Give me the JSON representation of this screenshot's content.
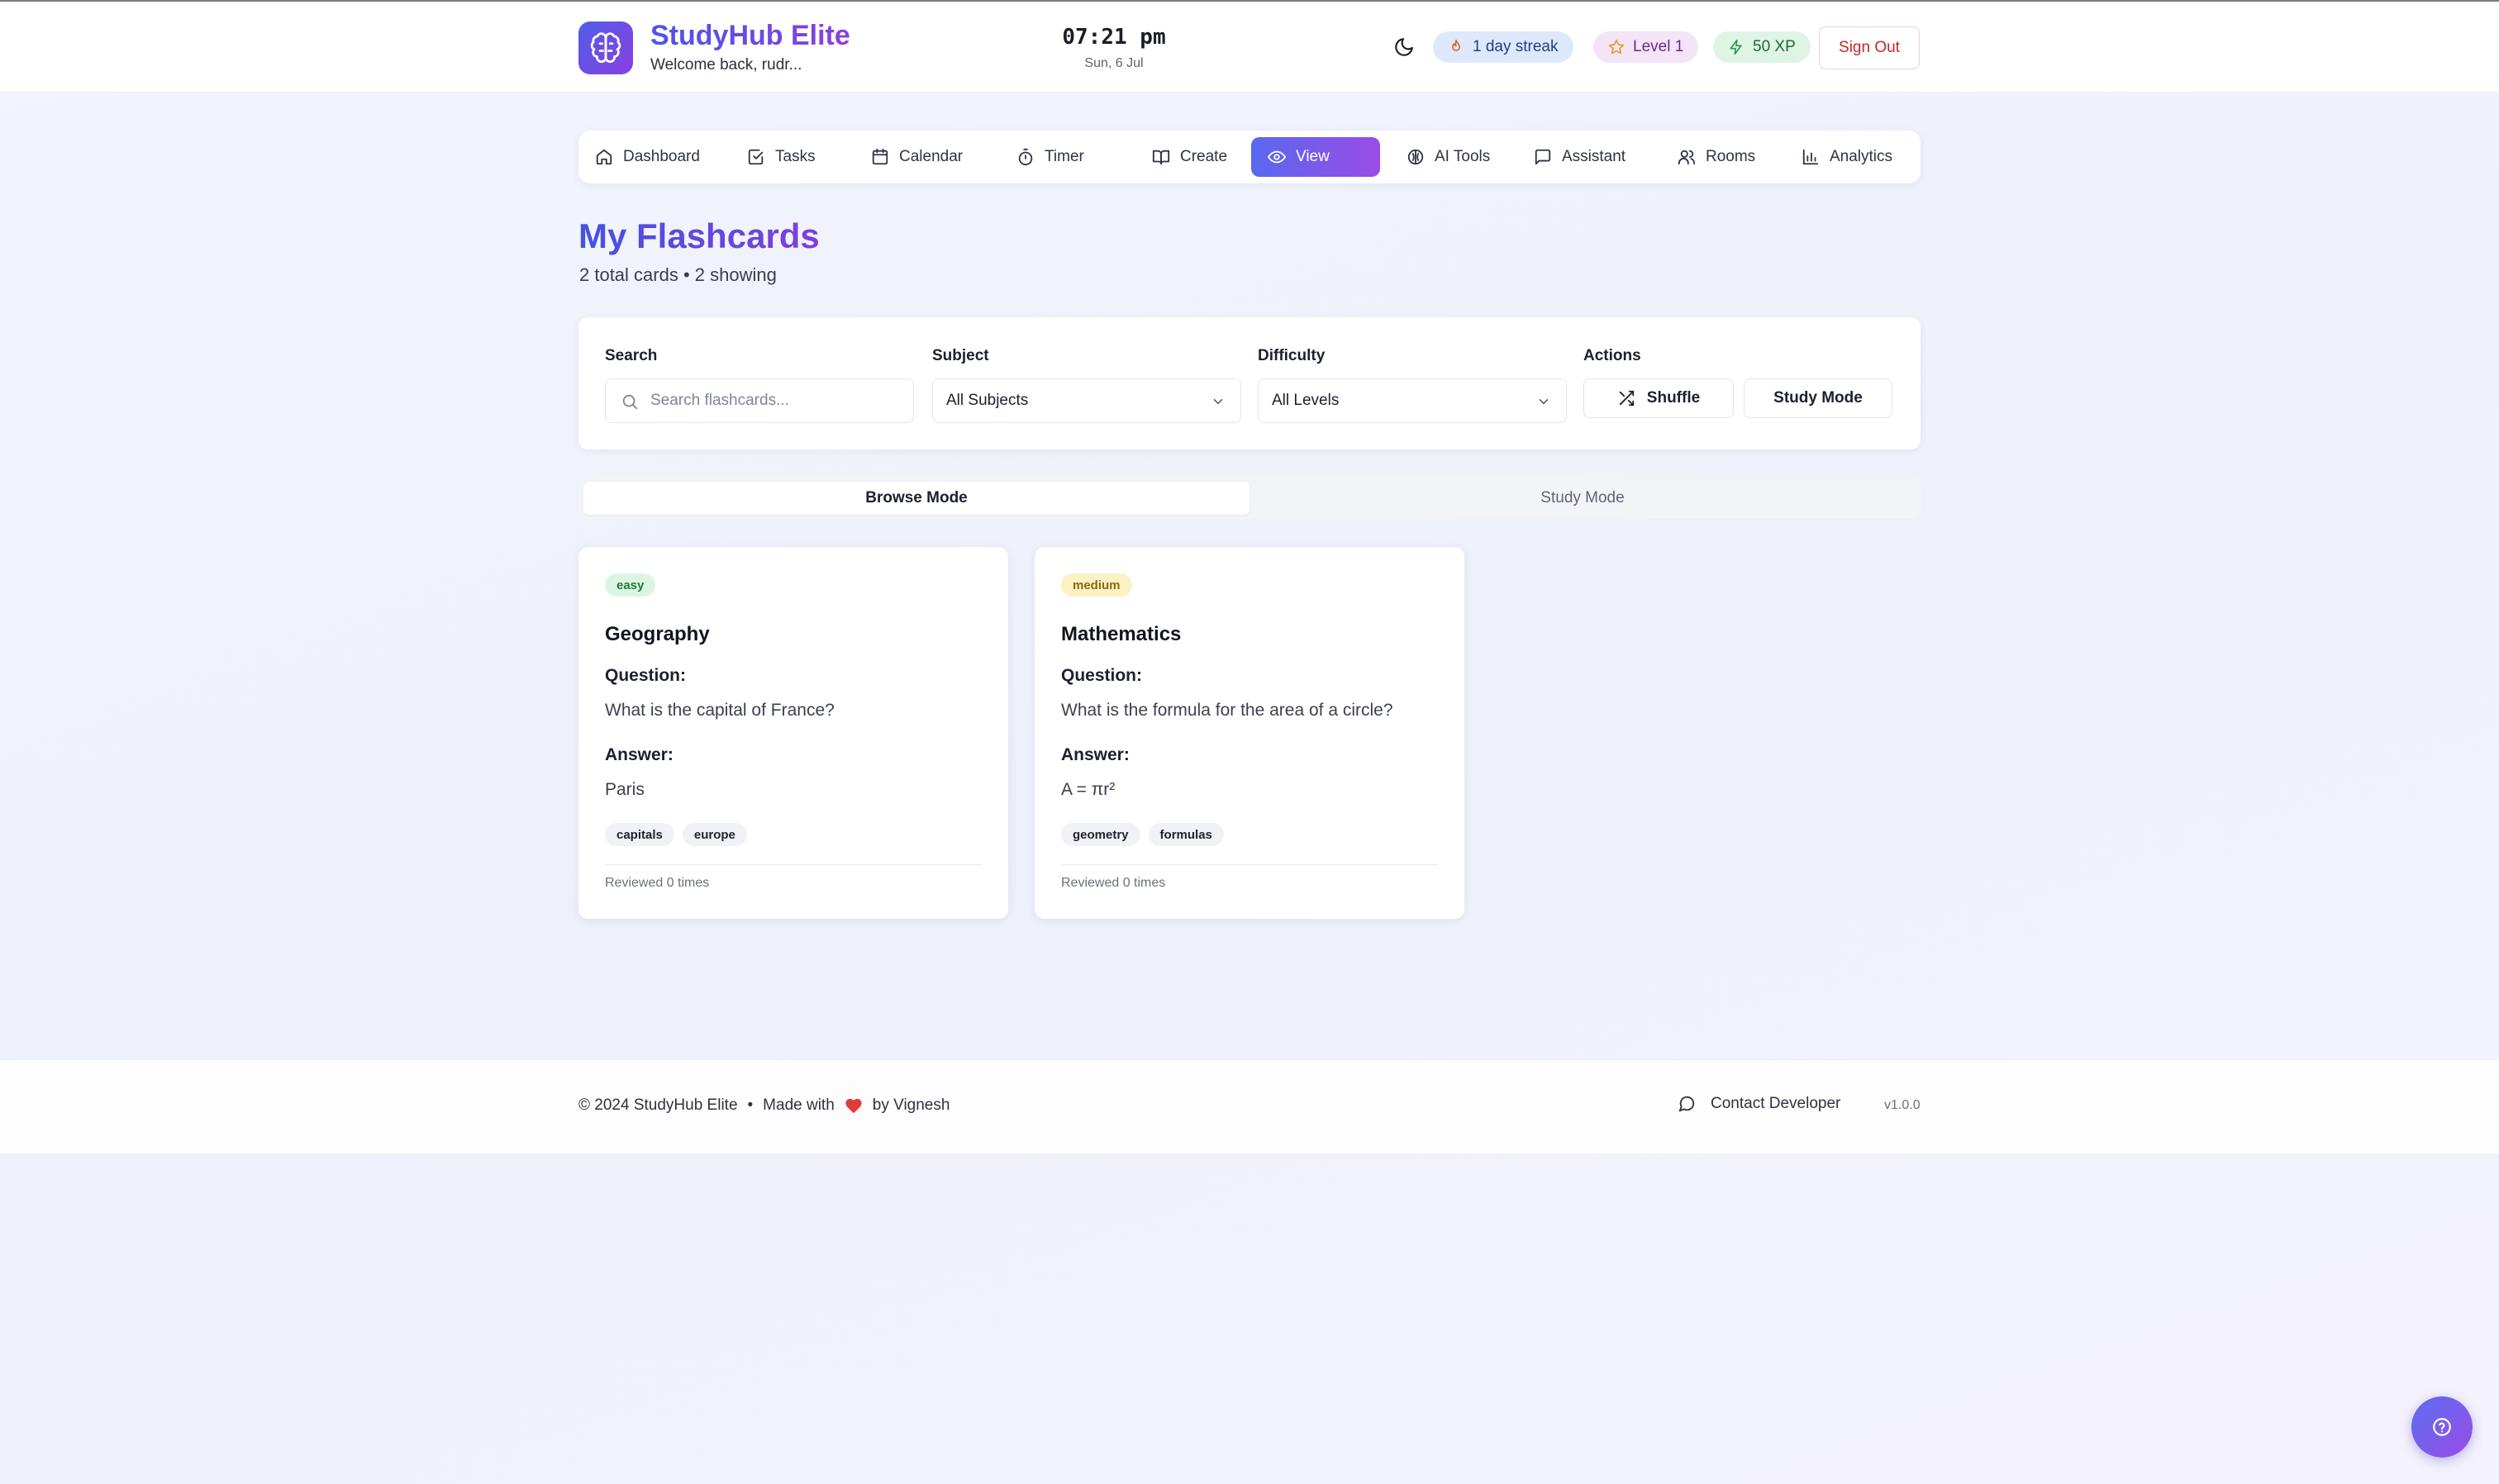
{
  "header": {
    "brand": "StudyHub Elite",
    "welcome": "Welcome back, rudr...",
    "time": "07:21 pm",
    "date": "Sun, 6 Jul",
    "streak": "1 day streak",
    "level": "Level 1",
    "xp": "50 XP",
    "sign_out": "Sign Out"
  },
  "nav": [
    {
      "label": "Dashboard",
      "icon": "home-icon"
    },
    {
      "label": "Tasks",
      "icon": "check-square-icon"
    },
    {
      "label": "Calendar",
      "icon": "calendar-icon"
    },
    {
      "label": "Timer",
      "icon": "timer-icon"
    },
    {
      "label": "Create",
      "icon": "book-open-icon"
    },
    {
      "label": "View",
      "icon": "eye-icon",
      "active": true
    },
    {
      "label": "AI Tools",
      "icon": "brain-icon"
    },
    {
      "label": "Assistant",
      "icon": "message-icon"
    },
    {
      "label": "Rooms",
      "icon": "users-icon"
    },
    {
      "label": "Analytics",
      "icon": "bar-chart-icon"
    }
  ],
  "page": {
    "title": "My Flashcards",
    "subtitle": "2 total cards • 2 showing"
  },
  "filters": {
    "search_label": "Search",
    "search_placeholder": "Search flashcards...",
    "subject_label": "Subject",
    "subject_value": "All Subjects",
    "difficulty_label": "Difficulty",
    "difficulty_value": "All Levels",
    "actions_label": "Actions",
    "shuffle": "Shuffle",
    "study_mode": "Study Mode"
  },
  "modes": {
    "browse": "Browse Mode",
    "study": "Study Mode"
  },
  "cards": [
    {
      "difficulty": "easy",
      "subject": "Geography",
      "question_label": "Question:",
      "question": "What is the capital of France?",
      "answer_label": "Answer:",
      "answer": "Paris",
      "tags": [
        "capitals",
        "europe"
      ],
      "reviewed": "Reviewed 0 times"
    },
    {
      "difficulty": "medium",
      "subject": "Mathematics",
      "question_label": "Question:",
      "question": "What is the formula for the area of a circle?",
      "answer_label": "Answer:",
      "answer": "A = πr²",
      "tags": [
        "geometry",
        "formulas"
      ],
      "reviewed": "Reviewed 0 times"
    }
  ],
  "footer": {
    "copyright": "© 2024 StudyHub Elite",
    "made_with": "Made with",
    "by": "by Vignesh",
    "contact": "Contact Developer",
    "version": "v1.0.0"
  },
  "colors": {
    "accent_start": "#4f5ee8",
    "accent_end": "#8a3fe0",
    "danger": "#c32828",
    "heart": "#e03a3a"
  }
}
